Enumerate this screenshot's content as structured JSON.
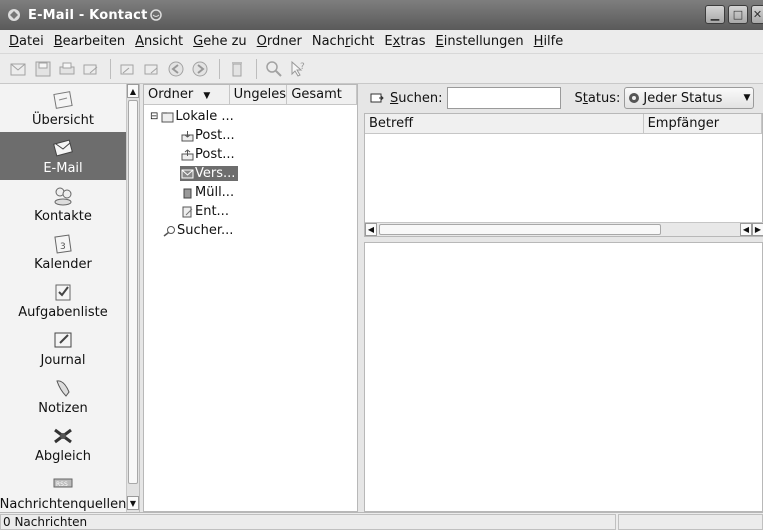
{
  "window": {
    "title": "E-Mail - Kontact"
  },
  "menubar": {
    "items": [
      {
        "label": "Datei",
        "key": "D",
        "rest": "atei"
      },
      {
        "label": "Bearbeiten",
        "key": "B",
        "rest": "earbeiten"
      },
      {
        "label": "Ansicht",
        "key": "A",
        "rest": "nsicht"
      },
      {
        "label": "Gehe zu",
        "key": "G",
        "rest": "ehe zu"
      },
      {
        "label": "Ordner",
        "key": "O",
        "rest": "rdner"
      },
      {
        "label": "Nachricht",
        "pre": "Nach",
        "key": "r",
        "rest": "icht"
      },
      {
        "label": "Extras",
        "pre": "E",
        "key": "x",
        "rest": "tras"
      },
      {
        "label": "Einstellungen",
        "key": "E",
        "rest": "instellungen"
      },
      {
        "label": "Hilfe",
        "key": "H",
        "rest": "ilfe"
      }
    ]
  },
  "sidebar": {
    "items": [
      {
        "label": "Übersicht",
        "icon": "overview-icon",
        "active": false
      },
      {
        "label": "E-Mail",
        "icon": "mail-icon",
        "active": true
      },
      {
        "label": "Kontakte",
        "icon": "contacts-icon",
        "active": false
      },
      {
        "label": "Kalender",
        "icon": "calendar-icon",
        "active": false
      },
      {
        "label": "Aufgabenliste",
        "icon": "todo-icon",
        "active": false
      },
      {
        "label": "Journal",
        "icon": "journal-icon",
        "active": false
      },
      {
        "label": "Notizen",
        "icon": "notes-icon",
        "active": false
      },
      {
        "label": "Abgleich",
        "icon": "sync-icon",
        "active": false
      },
      {
        "label": "Nachrichtenquellen",
        "icon": "rss-icon",
        "active": false
      }
    ]
  },
  "folders": {
    "columns": {
      "ordner": "Ordner",
      "ungelesen": "Ungelesen",
      "gesamt": "Gesamt"
    },
    "tree": [
      {
        "label": "Lokale ...",
        "level": 0,
        "icon": "folder-icon",
        "expander": "⊟"
      },
      {
        "label": "Post...",
        "level": 1,
        "icon": "inbox-icon"
      },
      {
        "label": "Post...",
        "level": 1,
        "icon": "outbox-icon"
      },
      {
        "label": "Vers...",
        "level": 1,
        "icon": "sent-icon",
        "selected": true
      },
      {
        "label": "Müll...",
        "level": 1,
        "icon": "trash-icon"
      },
      {
        "label": "Ent...",
        "level": 1,
        "icon": "drafts-icon"
      },
      {
        "label": "Sucher...",
        "level": 0,
        "icon": "search-folder-icon"
      }
    ]
  },
  "search": {
    "label_key": "S",
    "label_rest": "uchen:",
    "value": "",
    "status_pre": "S",
    "status_key": "t",
    "status_rest": "atus:",
    "status_value": "Jeder Status"
  },
  "messages": {
    "columns": {
      "subject": "Betreff",
      "recipient": "Empfänger"
    }
  },
  "statusbar": {
    "text": "0 Nachrichten"
  }
}
